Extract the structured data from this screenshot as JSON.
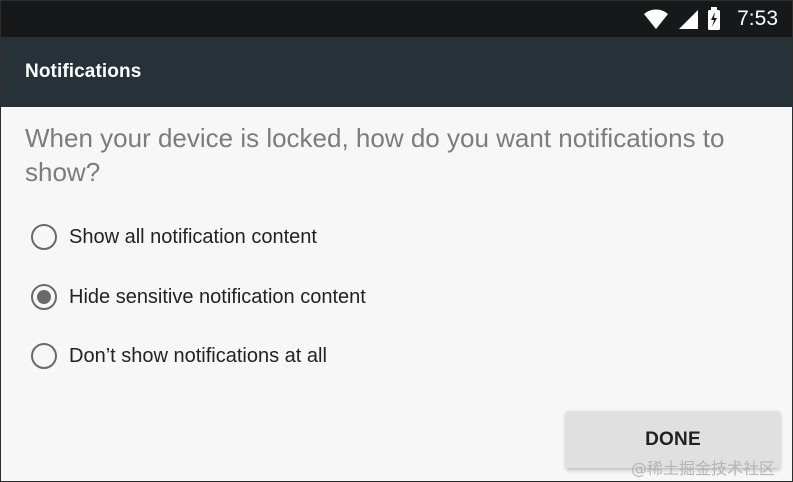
{
  "status_bar": {
    "time": "7:53",
    "icons": {
      "wifi": "wifi-icon",
      "signal": "cell-signal-icon",
      "battery": "battery-charging-icon"
    },
    "background_color": "#17181a"
  },
  "app_bar": {
    "title": "Notifications",
    "background_color": "#263238"
  },
  "main": {
    "question": "When your device is locked, how do you want notifications to show?",
    "options": [
      {
        "label": "Show all notification content",
        "selected": false
      },
      {
        "label": "Hide sensitive notification content",
        "selected": true
      },
      {
        "label": "Don’t show notifications at all",
        "selected": false
      }
    ],
    "done_label": "DONE"
  },
  "watermark": {
    "text": "@稀土掘金技术社区"
  },
  "colors": {
    "content_background": "#f7f7f7",
    "question_text": "#7c7c7c",
    "radio": "#6a6a6a",
    "button_background": "#e0e0e0"
  }
}
